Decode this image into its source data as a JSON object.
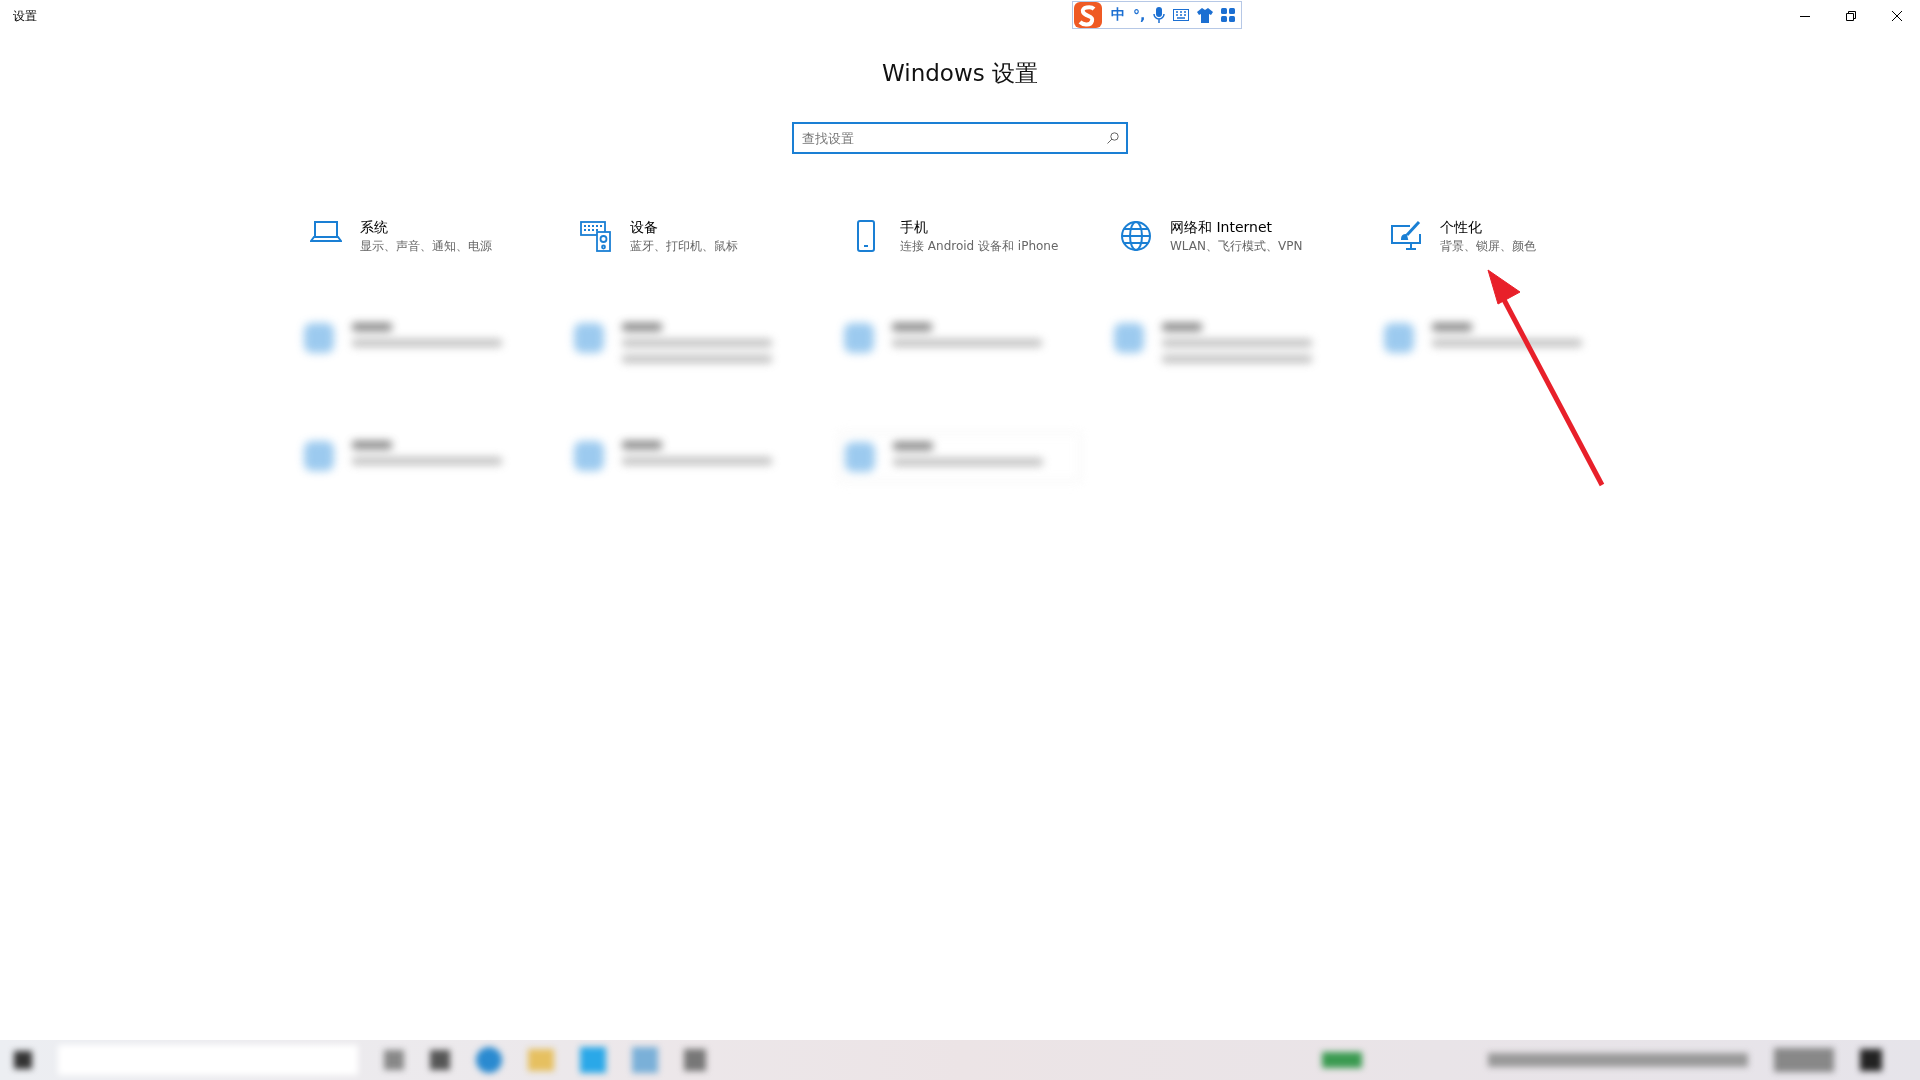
{
  "window": {
    "title": "设置"
  },
  "ime_toolbar": {
    "mode": "中",
    "punctuation": "°,"
  },
  "heading": "Windows 设置",
  "search": {
    "placeholder": "查找设置"
  },
  "categories": [
    {
      "kind": "laptop",
      "name": "系统",
      "description": "显示、声音、通知、电源"
    },
    {
      "kind": "devices",
      "name": "设备",
      "description": "蓝牙、打印机、鼠标"
    },
    {
      "kind": "phone",
      "name": "手机",
      "description": "连接 Android 设备和 iPhone"
    },
    {
      "kind": "globe",
      "name": "网络和 Internet",
      "description": "WLAN、飞行模式、VPN"
    },
    {
      "kind": "brush",
      "name": "个性化",
      "description": "背景、锁屏、颜色"
    }
  ],
  "blurred_categories": [
    {
      "kind": "single"
    },
    {
      "kind": "double"
    },
    {
      "kind": "single"
    },
    {
      "kind": "double"
    },
    {
      "kind": "single"
    },
    {
      "kind": "single"
    },
    {
      "kind": "single"
    },
    {
      "kind": "framed"
    }
  ],
  "annotation_arrow": {
    "color": "#e8202a"
  }
}
